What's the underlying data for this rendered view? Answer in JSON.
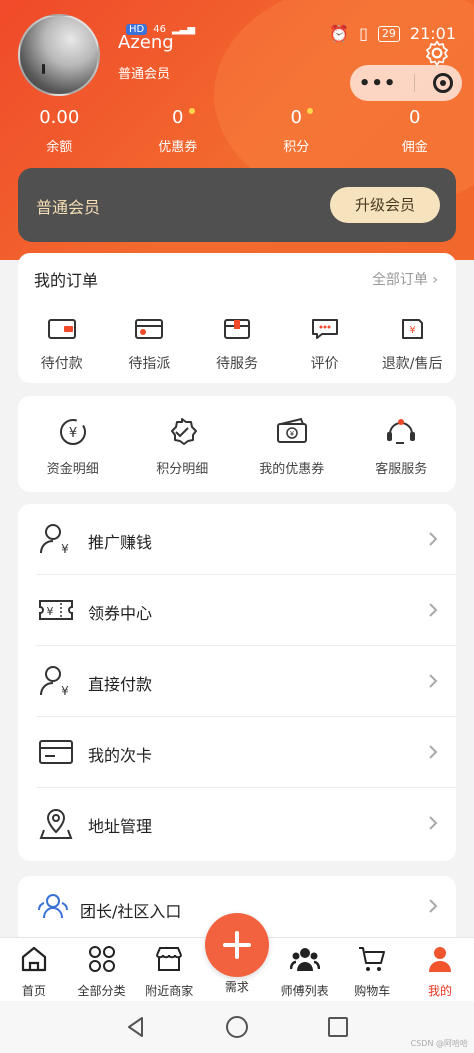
{
  "status_bar": {
    "left_label": "46",
    "time": "21:01",
    "battery": "29"
  },
  "profile": {
    "username": "Azeng",
    "level": "普通会员"
  },
  "stats": [
    {
      "value": "0.00",
      "label": "余额",
      "dot": false
    },
    {
      "value": "0",
      "label": "优惠券",
      "dot": true
    },
    {
      "value": "0",
      "label": "积分",
      "dot": true
    },
    {
      "value": "0",
      "label": "佣金",
      "dot": false
    }
  ],
  "member_card": {
    "title": "普通会员",
    "upgrade_label": "升级会员"
  },
  "orders": {
    "title": "我的订单",
    "all_label": "全部订单",
    "items": [
      {
        "label": "待付款",
        "icon": "wallet-icon"
      },
      {
        "label": "待指派",
        "icon": "card-icon"
      },
      {
        "label": "待服务",
        "icon": "box-icon"
      },
      {
        "label": "评价",
        "icon": "comment-icon"
      },
      {
        "label": "退款/售后",
        "icon": "refund-icon"
      }
    ]
  },
  "services": [
    {
      "label": "资金明细",
      "icon": "yen-cycle-icon"
    },
    {
      "label": "积分明细",
      "icon": "badge-check-icon"
    },
    {
      "label": "我的优惠券",
      "icon": "coupon-icon"
    },
    {
      "label": "客服服务",
      "icon": "headset-icon"
    }
  ],
  "menu": [
    {
      "label": "推广赚钱",
      "icon": "user-yen-icon"
    },
    {
      "label": "领券中心",
      "icon": "ticket-icon"
    },
    {
      "label": "直接付款",
      "icon": "user-yen-icon"
    },
    {
      "label": "我的次卡",
      "icon": "card-icon"
    },
    {
      "label": "地址管理",
      "icon": "location-icon"
    }
  ],
  "team": {
    "label": "团长/社区入口",
    "icon": "team-icon"
  },
  "tabbar": [
    {
      "label": "首页",
      "icon": "home-icon",
      "active": false
    },
    {
      "label": "全部分类",
      "icon": "grid-icon",
      "active": false
    },
    {
      "label": "附近商家",
      "icon": "store-icon",
      "active": false
    },
    {
      "label": "需求",
      "icon": "plus-icon",
      "active": false
    },
    {
      "label": "师傅列表",
      "icon": "people-icon",
      "active": false
    },
    {
      "label": "购物车",
      "icon": "cart-icon",
      "active": false
    },
    {
      "label": "我的",
      "icon": "person-icon",
      "active": true
    }
  ],
  "watermark": "CSDN @阿哈哈",
  "colors": {
    "accent": "#f04a2a",
    "member_card": "#505050",
    "gold": "#f6e3bd"
  }
}
